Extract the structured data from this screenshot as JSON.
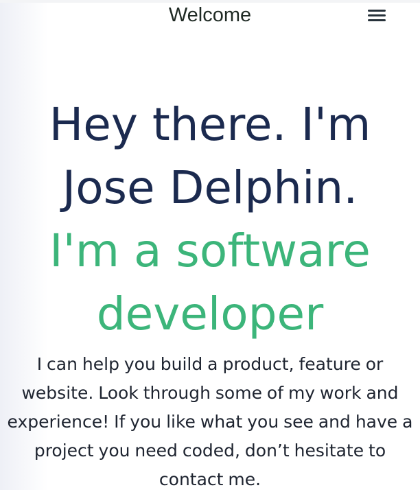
{
  "header": {
    "title": "Welcome",
    "menu_icon": "hamburger-menu-icon"
  },
  "hero": {
    "name_lines": [
      "Hey there. I'm",
      "Jose Delphin."
    ],
    "role_lines": [
      "I'm a software",
      "developer"
    ]
  },
  "intro": {
    "text": "I can help you build a product, feature or website. Look through some of my work and experience! If you like what you see and have a project you need coded, don’t hesitate to contact me."
  },
  "colors": {
    "name": "#1b2a4f",
    "role": "#3cb57a",
    "text": "#1e2430"
  }
}
